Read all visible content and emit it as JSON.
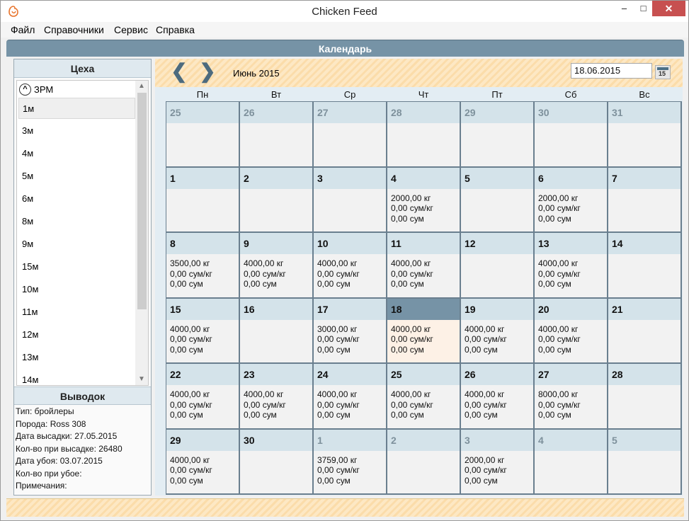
{
  "window": {
    "title": "Chicken Feed",
    "minimize": "–",
    "maximize": "□",
    "close": "✕"
  },
  "menu": [
    "Файл",
    "Справочники",
    "Сервис",
    "Справка"
  ],
  "header": {
    "title": "Календарь"
  },
  "shops_panel": {
    "title": "Цеха",
    "group": "ЗРМ",
    "items": [
      "1м",
      "3м",
      "4м",
      "5м",
      "6м",
      "8м",
      "9м",
      "15м",
      "10м",
      "11м",
      "12м",
      "13м",
      "14м"
    ],
    "selected_index": 0
  },
  "brood_panel": {
    "title": "Выводок",
    "lines": [
      "Тип: бройлеры",
      "Порода: Ross 308",
      "Дата высадки: 27.05.2015",
      "Кол-во при высадке: 26480",
      "Дата убоя: 03.07.2015",
      "Кол-во при убое:",
      "Примечания:"
    ]
  },
  "calendar": {
    "month_label": "Июнь 2015",
    "date_value": "18.06.2015",
    "date_button_num": "15",
    "nav_prev": "❮",
    "nav_next": "❯",
    "weekdays": [
      "Пн",
      "Вт",
      "Ср",
      "Чт",
      "Пт",
      "Сб",
      "Вс"
    ],
    "weeks": [
      [
        {
          "day": "25",
          "other": true,
          "lines": []
        },
        {
          "day": "26",
          "other": true,
          "lines": []
        },
        {
          "day": "27",
          "other": true,
          "lines": []
        },
        {
          "day": "28",
          "other": true,
          "lines": []
        },
        {
          "day": "29",
          "other": true,
          "lines": []
        },
        {
          "day": "30",
          "other": true,
          "lines": []
        },
        {
          "day": "31",
          "other": true,
          "lines": []
        }
      ],
      [
        {
          "day": "1",
          "lines": []
        },
        {
          "day": "2",
          "lines": []
        },
        {
          "day": "3",
          "lines": []
        },
        {
          "day": "4",
          "lines": [
            "2000,00 кг",
            "0,00 сум/кг",
            "0,00 сум"
          ]
        },
        {
          "day": "5",
          "lines": []
        },
        {
          "day": "6",
          "lines": [
            "2000,00 кг",
            "0,00 сум/кг",
            "0,00 сум"
          ]
        },
        {
          "day": "7",
          "lines": []
        }
      ],
      [
        {
          "day": "8",
          "lines": [
            "3500,00 кг",
            "0,00 сум/кг",
            "0,00 сум"
          ]
        },
        {
          "day": "9",
          "lines": [
            "4000,00 кг",
            "0,00 сум/кг",
            "0,00 сум"
          ]
        },
        {
          "day": "10",
          "lines": [
            "4000,00 кг",
            "0,00 сум/кг",
            "0,00 сум"
          ]
        },
        {
          "day": "11",
          "lines": [
            "4000,00 кг",
            "0,00 сум/кг",
            "0,00 сум"
          ]
        },
        {
          "day": "12",
          "lines": []
        },
        {
          "day": "13",
          "lines": [
            "4000,00 кг",
            "0,00 сум/кг",
            "0,00 сум"
          ]
        },
        {
          "day": "14",
          "lines": []
        }
      ],
      [
        {
          "day": "15",
          "lines": [
            "4000,00 кг",
            "0,00 сум/кг",
            "0,00 сум"
          ]
        },
        {
          "day": "16",
          "lines": []
        },
        {
          "day": "17",
          "lines": [
            "3000,00 кг",
            "0,00 сум/кг",
            "0,00 сум"
          ]
        },
        {
          "day": "18",
          "today": true,
          "lines": [
            "4000,00 кг",
            "0,00 сум/кг",
            "0,00 сум"
          ]
        },
        {
          "day": "19",
          "lines": [
            "4000,00 кг",
            "0,00 сум/кг",
            "0,00 сум"
          ]
        },
        {
          "day": "20",
          "lines": [
            "4000,00 кг",
            "0,00 сум/кг",
            "0,00 сум"
          ]
        },
        {
          "day": "21",
          "lines": []
        }
      ],
      [
        {
          "day": "22",
          "lines": [
            "4000,00 кг",
            "0,00 сум/кг",
            "0,00 сум"
          ]
        },
        {
          "day": "23",
          "lines": [
            "4000,00 кг",
            "0,00 сум/кг",
            "0,00 сум"
          ]
        },
        {
          "day": "24",
          "lines": [
            "4000,00 кг",
            "0,00 сум/кг",
            "0,00 сум"
          ]
        },
        {
          "day": "25",
          "lines": [
            "4000,00 кг",
            "0,00 сум/кг",
            "0,00 сум"
          ]
        },
        {
          "day": "26",
          "lines": [
            "4000,00 кг",
            "0,00 сум/кг",
            "0,00 сум"
          ]
        },
        {
          "day": "27",
          "lines": [
            "8000,00 кг",
            "0,00 сум/кг",
            "0,00 сум"
          ]
        },
        {
          "day": "28",
          "lines": []
        }
      ],
      [
        {
          "day": "29",
          "lines": [
            "4000,00 кг",
            "0,00 сум/кг",
            "0,00 сум"
          ]
        },
        {
          "day": "30",
          "lines": []
        },
        {
          "day": "1",
          "other": true,
          "lines": [
            "3759,00 кг",
            "0,00 сум/кг",
            "0,00 сум"
          ]
        },
        {
          "day": "2",
          "other": true,
          "lines": []
        },
        {
          "day": "3",
          "other": true,
          "lines": [
            "2000,00 кг",
            "0,00 сум/кг",
            "0,00 сум"
          ]
        },
        {
          "day": "4",
          "other": true,
          "lines": []
        },
        {
          "day": "5",
          "other": true,
          "lines": []
        }
      ]
    ]
  }
}
